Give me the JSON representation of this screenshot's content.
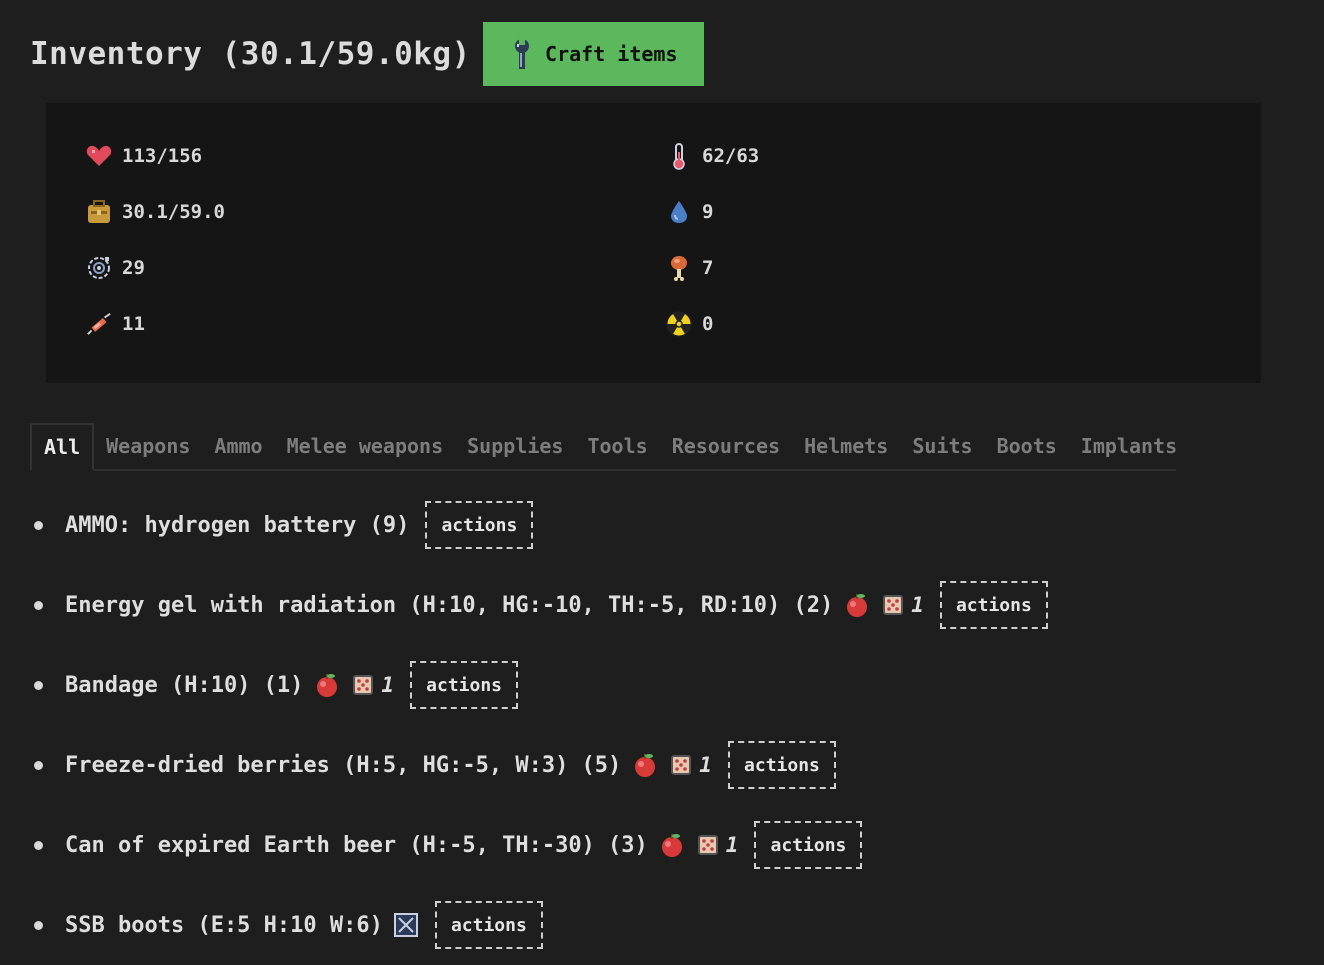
{
  "header": {
    "title": "Inventory (30.1/59.0kg)",
    "craft_label": "Craft items"
  },
  "stats": {
    "health": "113/156",
    "weight": "30.1/59.0",
    "radiation_resist": "29",
    "xp": "11",
    "temperature": "62/63",
    "water": "9",
    "hunger": "7",
    "radiation": "0"
  },
  "tabs": [
    {
      "label": "All"
    },
    {
      "label": "Weapons"
    },
    {
      "label": "Ammo"
    },
    {
      "label": "Melee weapons"
    },
    {
      "label": "Supplies"
    },
    {
      "label": "Tools"
    },
    {
      "label": "Resources"
    },
    {
      "label": "Helmets"
    },
    {
      "label": "Suits"
    },
    {
      "label": "Boots"
    },
    {
      "label": "Implants"
    }
  ],
  "items": [
    {
      "name": "AMMO: hydrogen battery (9)",
      "actions": "actions"
    },
    {
      "name": "Energy gel with radiation (H:10, HG:-10, TH:-5, RD:10) (2)",
      "count": "1",
      "actions": "actions"
    },
    {
      "name": "Bandage (H:10) (1)",
      "count": "1",
      "actions": "actions"
    },
    {
      "name": "Freeze-dried berries (H:5, HG:-5, W:3) (5)",
      "count": "1",
      "actions": "actions"
    },
    {
      "name": "Can of expired Earth beer (H:-5, TH:-30) (3)",
      "count": "1",
      "actions": "actions"
    },
    {
      "name": "SSB boots (E:5 H:10 W:6)",
      "actions": "actions"
    }
  ],
  "colors": {
    "background": "#1e1e1e",
    "panel": "#151515",
    "craft_button": "#5cb85c"
  }
}
